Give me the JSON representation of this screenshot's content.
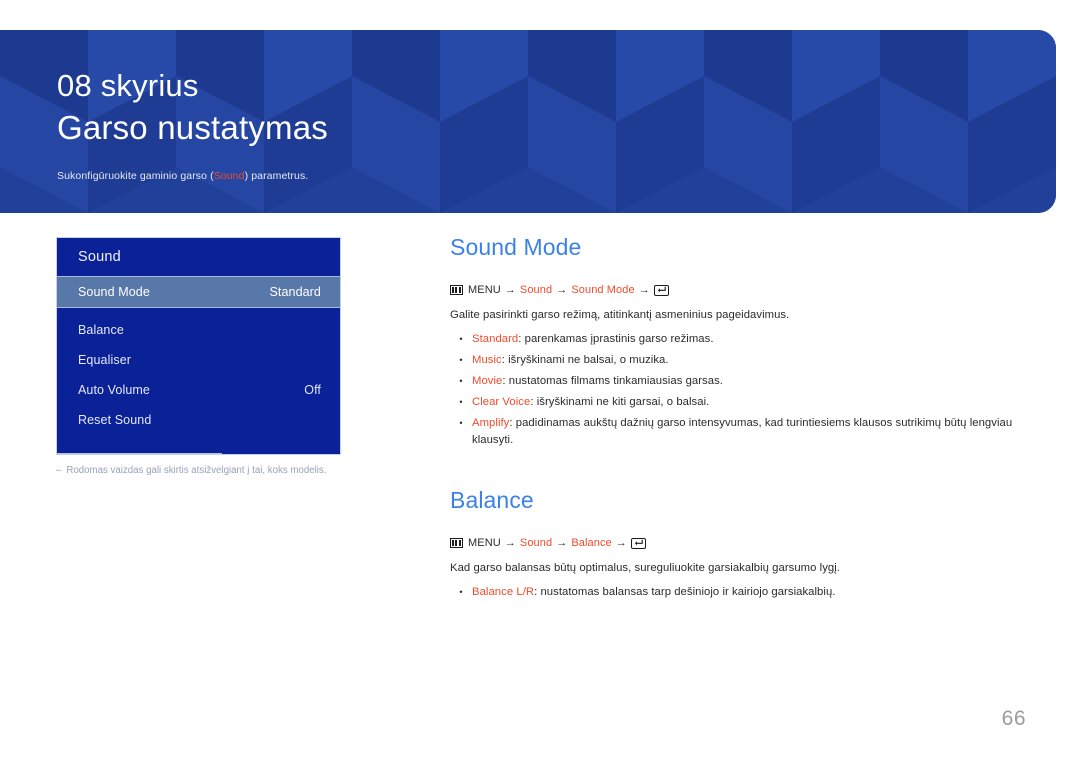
{
  "banner": {
    "chapter_number": "08 skyrius",
    "chapter_title": "Garso nustatymas",
    "subtitle_before": "Sukonfigūruokite gaminio garso (",
    "subtitle_accent": "Sound",
    "subtitle_after": ") parametrus.",
    "background_color": "#21409a"
  },
  "osd_menu": {
    "header": "Sound",
    "rows": [
      {
        "label": "Sound Mode",
        "value": "Standard",
        "selected": true
      },
      {
        "label": "Balance",
        "value": "",
        "selected": false
      },
      {
        "label": "Equaliser",
        "value": "",
        "selected": false
      },
      {
        "label": "Auto Volume",
        "value": "Off",
        "selected": false
      },
      {
        "label": "Reset Sound",
        "value": "",
        "selected": false
      }
    ],
    "background_color": "#0a2198",
    "selected_color": "#5778a8"
  },
  "footnote": {
    "dash": "‒",
    "text": "Rodomas vaizdas gali skirtis atsižvelgiant į tai, koks modelis."
  },
  "sections": [
    {
      "title": "Sound Mode",
      "breadcrumb": {
        "menu_label": "MENU",
        "arrow": "→",
        "crumbs": [
          "Sound",
          "Sound Mode"
        ]
      },
      "paragraph": "Galite pasirinkti garso režimą, atitinkantį asmeninius pageidavimus.",
      "bullets": [
        {
          "term": "Standard",
          "desc": ": parenkamas įprastinis garso režimas."
        },
        {
          "term": "Music",
          "desc": ": išryškinami ne balsai, o muzika."
        },
        {
          "term": "Movie",
          "desc": ": nustatomas filmams tinkamiausias garsas."
        },
        {
          "term": "Clear Voice",
          "desc": ": išryškinami ne kiti garsai, o balsai."
        },
        {
          "term": "Amplify",
          "desc": ": padidinamas aukštų dažnių garso intensyvumas, kad turintiesiems klausos sutrikimų būtų lengviau klausyti."
        }
      ]
    },
    {
      "title": "Balance",
      "breadcrumb": {
        "menu_label": "MENU",
        "arrow": "→",
        "crumbs": [
          "Sound",
          "Balance"
        ]
      },
      "paragraph": "Kad garso balansas būtų optimalus, sureguliuokite garsiakalbių garsumo lygį.",
      "bullets": [
        {
          "term": "Balance L/R",
          "desc": ": nustatomas balansas tarp dešiniojo ir kairiojo garsiakalbių."
        }
      ]
    }
  ],
  "page_number": "66",
  "colors": {
    "heading_blue": "#3b82e8",
    "accent_orange": "#ef4b2c",
    "body_text": "#2b2b2b",
    "page_number_gray": "#9b9b9b"
  }
}
